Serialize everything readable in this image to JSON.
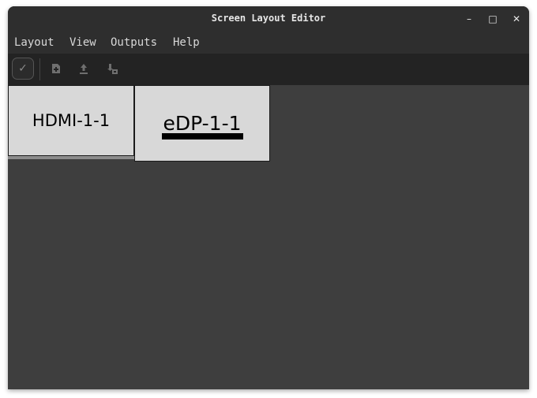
{
  "window": {
    "title": "Screen Layout Editor"
  },
  "window_controls": {
    "minimize_glyph": "–",
    "maximize_glyph": "□",
    "close_glyph": "✕"
  },
  "menu": {
    "items": [
      {
        "label": "Layout"
      },
      {
        "label": "View"
      },
      {
        "label": "Outputs"
      },
      {
        "label": "Help"
      }
    ]
  },
  "toolbar": {
    "apply_icon": "check-icon",
    "buttons": [
      {
        "icon": "new-layout-icon"
      },
      {
        "icon": "open-layout-icon"
      },
      {
        "icon": "save-layout-icon"
      }
    ]
  },
  "outputs": [
    {
      "name": "HDMI-1-1",
      "primary": false
    },
    {
      "name": "eDP-1-1",
      "primary": true
    }
  ],
  "colors": {
    "titlebar": "#2e2e2e",
    "toolbar": "#232323",
    "canvas": "#3e3e3e",
    "output_fill": "#d8d8d8",
    "text_light": "#e6e6e6"
  }
}
